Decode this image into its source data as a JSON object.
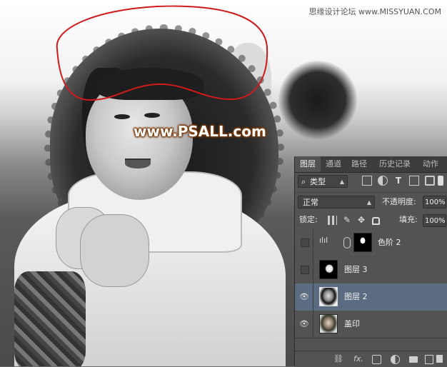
{
  "site_credit": "思缘设计论坛 www.MISSYUAN.COM",
  "watermark": "www.PSALL.com",
  "layers_panel": {
    "tabs": [
      {
        "label": "图层",
        "active": true
      },
      {
        "label": "通道",
        "active": false
      },
      {
        "label": "路径",
        "active": false
      },
      {
        "label": "历史记录",
        "active": false
      },
      {
        "label": "动作",
        "active": false
      }
    ],
    "filter": {
      "selected": "类型",
      "search_glyph": "⌕"
    },
    "blend_mode": "正常",
    "opacity_label": "不透明度:",
    "opacity_value": "100%",
    "lock_label": "锁定:",
    "fill_label": "填充:",
    "fill_value": "100%",
    "layers": [
      {
        "name": "色阶 2",
        "visible": false,
        "selected": false,
        "kind": "adjustment"
      },
      {
        "name": "图层 3",
        "visible": false,
        "selected": false,
        "kind": "mask-white-on-black"
      },
      {
        "name": "图层 2",
        "visible": true,
        "selected": true,
        "kind": "photo-bw"
      },
      {
        "name": "盖印",
        "visible": true,
        "selected": false,
        "kind": "photo-color"
      }
    ],
    "footer_icons": [
      "link-icon",
      "fx-icon",
      "add-mask-icon",
      "adjustment-icon",
      "new-group-icon",
      "new-layer-icon",
      "delete-icon"
    ],
    "footer_fx_label": "fx."
  },
  "colors": {
    "panel_bg": "#535353",
    "selected_row": "#5b6b82",
    "selection_outline": "#d11a1a",
    "watermark_outline": "#7a3a0a"
  }
}
